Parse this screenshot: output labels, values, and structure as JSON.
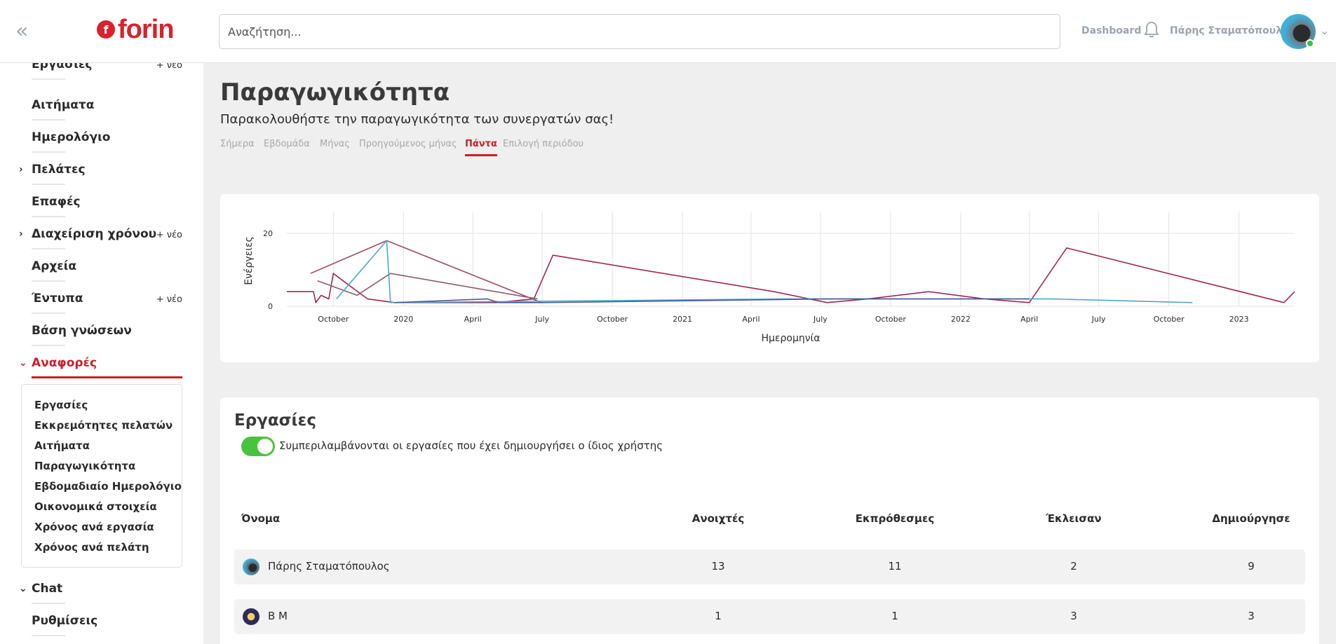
{
  "header": {
    "collapse_icon": "«",
    "logo_text": "forin",
    "search_placeholder": "Αναζήτηση...",
    "dashboard_link": "Dashboard",
    "user_name": "Πάρης Σταματόπουλος",
    "brand_color": "#d9222a"
  },
  "sidebar": {
    "items": [
      {
        "label": "Εργασίες",
        "new": "+ νέο",
        "partial": true
      },
      {
        "label": "Αιτήματα"
      },
      {
        "label": "Ημερολόγιο"
      },
      {
        "label": "Πελάτες",
        "chevron": "›"
      },
      {
        "label": "Επαφές"
      },
      {
        "label": "Διαχείριση χρόνου",
        "chevron": "›",
        "new": "+ νέο"
      },
      {
        "label": "Αρχεία"
      },
      {
        "label": "Έντυπα",
        "new": "+ νέο"
      },
      {
        "label": "Βάση γνώσεων"
      },
      {
        "label": "Αναφορές",
        "chevron": "⌄",
        "active": true
      },
      {
        "label": "Chat",
        "chevron": "⌄"
      },
      {
        "label": "Ρυθμίσεις"
      }
    ],
    "reports_submenu": [
      "Εργασίες",
      "Εκκρεμότητες πελατών",
      "Αιτήματα",
      "Παραγωγικότητα",
      "Εβδομαδιαίο Ημερολόγιο",
      "Οικονομικά στοιχεία",
      "Χρόνος ανά εργασία",
      "Χρόνος ανά πελάτη"
    ],
    "active_color": "#c9202b"
  },
  "main": {
    "title": "Παραγωγικότητα",
    "subtitle": "Παρακολουθήστε την παραγωγικότητα των συνεργατών σας!",
    "tabs": [
      {
        "label": "Σήμερα"
      },
      {
        "label": "Εβδομάδα"
      },
      {
        "label": "Μήνας"
      },
      {
        "label": "Προηγούμενος μήνας"
      },
      {
        "label": "Πάντα",
        "active": true
      },
      {
        "label": "Επιλογή περιόδου"
      }
    ]
  },
  "chart_data": {
    "type": "line",
    "xlabel": "Ημερομηνία",
    "ylabel": "Ενέργειες",
    "ylim": [
      0,
      25
    ],
    "yticks": [
      0,
      20
    ],
    "xlim": [
      "2019-08-01",
      "2023-03-15"
    ],
    "xticks": [
      {
        "date": "2019-10-01",
        "label": "October"
      },
      {
        "date": "2020-01-01",
        "label": "2020"
      },
      {
        "date": "2020-04-01",
        "label": "April"
      },
      {
        "date": "2020-07-01",
        "label": "July"
      },
      {
        "date": "2020-10-01",
        "label": "October"
      },
      {
        "date": "2021-01-01",
        "label": "2021"
      },
      {
        "date": "2021-04-01",
        "label": "April"
      },
      {
        "date": "2021-07-01",
        "label": "July"
      },
      {
        "date": "2021-10-01",
        "label": "October"
      },
      {
        "date": "2022-01-01",
        "label": "2022"
      },
      {
        "date": "2022-04-01",
        "label": "April"
      },
      {
        "date": "2022-07-01",
        "label": "July"
      },
      {
        "date": "2022-10-01",
        "label": "October"
      },
      {
        "date": "2023-01-01",
        "label": "2023"
      }
    ],
    "grid": true,
    "series": [
      {
        "color": "#a0284f",
        "points": [
          [
            "2019-08-01",
            4
          ],
          [
            "2019-09-05",
            4
          ],
          [
            "2019-09-08",
            1
          ],
          [
            "2019-09-15",
            3
          ],
          [
            "2019-09-25",
            2
          ],
          [
            "2019-10-01",
            9
          ],
          [
            "2019-10-20",
            6
          ],
          [
            "2019-11-15",
            2
          ],
          [
            "2019-12-20",
            1
          ],
          [
            "2020-05-01",
            1
          ],
          [
            "2020-06-20",
            2
          ],
          [
            "2020-07-15",
            14
          ],
          [
            "2021-05-01",
            4
          ],
          [
            "2021-07-10",
            1
          ],
          [
            "2021-09-01",
            2
          ],
          [
            "2021-11-20",
            4
          ],
          [
            "2022-02-01",
            2
          ],
          [
            "2022-04-01",
            1
          ],
          [
            "2022-05-20",
            16
          ],
          [
            "2023-03-01",
            1
          ],
          [
            "2023-03-15",
            4
          ]
        ]
      },
      {
        "color": "#9c4a63",
        "points": [
          [
            "2019-09-01",
            9
          ],
          [
            "2019-12-10",
            18
          ],
          [
            "2020-06-30",
            1
          ]
        ]
      },
      {
        "color": "#8c5a70",
        "points": [
          [
            "2019-09-10",
            7
          ],
          [
            "2019-11-01",
            3
          ],
          [
            "2019-12-15",
            9
          ],
          [
            "2020-06-25",
            2
          ]
        ]
      },
      {
        "color": "#4aa9c8",
        "points": [
          [
            "2019-10-05",
            2
          ],
          [
            "2019-12-10",
            18
          ],
          [
            "2019-12-15",
            1
          ],
          [
            "2021-05-20",
            2
          ],
          [
            "2021-07-01",
            2
          ],
          [
            "2021-10-01",
            2
          ],
          [
            "2022-05-01",
            2
          ],
          [
            "2022-11-01",
            1
          ]
        ]
      },
      {
        "color": "#4a5aa0",
        "points": [
          [
            "2019-12-20",
            1
          ],
          [
            "2020-04-20",
            2
          ],
          [
            "2020-05-05",
            1
          ],
          [
            "2020-06-30",
            1
          ],
          [
            "2021-07-10",
            2
          ],
          [
            "2022-04-01",
            2
          ]
        ]
      }
    ]
  },
  "tasks_table": {
    "title": "Εργασίες",
    "toggle_on": true,
    "toggle_label": "Συμπεριλαμβάνονται οι εργασίες που έχει δημιουργήσει ο ίδιος χρήστης",
    "headers": [
      "Όνομα",
      "Ανοιχτές",
      "Εκπρόθεσμες",
      "Έκλεισαν",
      "Δημιούργησε"
    ],
    "rows": [
      {
        "name": "Πάρης Σταματόπουλος",
        "open": "13",
        "overdue": "11",
        "closed": "2",
        "created": "9"
      },
      {
        "name": "B M",
        "open": "1",
        "overdue": "1",
        "closed": "3",
        "created": "3"
      }
    ]
  }
}
